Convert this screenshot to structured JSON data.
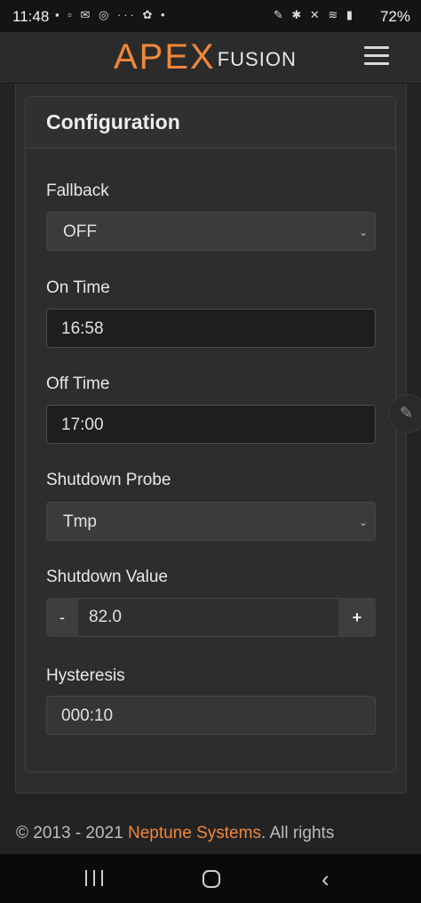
{
  "status_bar": {
    "time": "11:48",
    "battery": "72%",
    "left_icons": [
      "message-icon",
      "ring-icon",
      "mail-icon",
      "threads-icon",
      "voicemail-icon",
      "android-icon",
      "dot-icon"
    ],
    "right_icons": [
      "nfc-icon",
      "bluetooth-icon",
      "mute-icon",
      "wifi-icon",
      "signal-icon"
    ]
  },
  "app_bar": {
    "logo_primary": "APEX",
    "logo_secondary": "FUSION",
    "menu_icon": "hamburger-icon"
  },
  "config": {
    "title": "Configuration",
    "fallback": {
      "label": "Fallback",
      "value": "OFF"
    },
    "on_time": {
      "label": "On Time",
      "value": "16:58"
    },
    "off_time": {
      "label": "Off Time",
      "value": "17:00"
    },
    "shutdown_probe": {
      "label": "Shutdown Probe",
      "value": "Tmp"
    },
    "shutdown_value": {
      "label": "Shutdown Value",
      "value": "82.0",
      "minus": "-",
      "plus": "+"
    },
    "hysteresis": {
      "label": "Hysteresis",
      "value": "000:10"
    }
  },
  "footer": {
    "prefix": "© 2013 - 2021 ",
    "link": "Neptune Systems",
    "suffix": ". All rights"
  },
  "colors": {
    "accent": "#f0883a",
    "background": "#232323",
    "card": "#2d2d2d"
  }
}
